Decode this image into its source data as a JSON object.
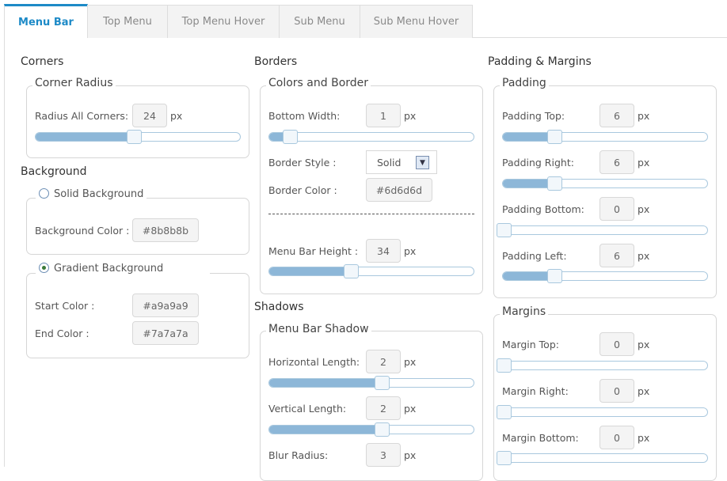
{
  "tabs": [
    {
      "label": "Menu Bar",
      "active": true
    },
    {
      "label": "Top Menu",
      "active": false
    },
    {
      "label": "Top Menu Hover",
      "active": false
    },
    {
      "label": "Sub Menu",
      "active": false
    },
    {
      "label": "Sub Menu Hover",
      "active": false
    }
  ],
  "unit": "px",
  "corners": {
    "heading": "Corners",
    "legend": "Corner Radius",
    "radius_label": "Radius All Corners:",
    "radius_value": "24",
    "radius_slider_fraction": 0.48
  },
  "background": {
    "heading": "Background",
    "solid_legend": "Solid Background",
    "solid_selected": false,
    "bg_color_label": "Background Color :",
    "bg_color": "#8b8b8b",
    "gradient_legend": "Gradient Background",
    "gradient_selected": true,
    "start_label": "Start Color :",
    "start_color": "#a9a9a9",
    "end_label": "End Color :",
    "end_color": "#7a7a7a"
  },
  "borders": {
    "heading": "Borders",
    "legend": "Colors and Border",
    "bottom_width_label": "Bottom Width:",
    "bottom_width_value": "1",
    "bottom_width_fraction": 0.1,
    "style_label": "Border Style :",
    "style_value": "Solid",
    "color_label": "Border Color :",
    "color_value": "#6d6d6d",
    "height_label": "Menu Bar Height :",
    "height_value": "34",
    "height_fraction": 0.4
  },
  "shadows": {
    "heading": "Shadows",
    "legend": "Menu Bar Shadow",
    "horizontal_label": "Horizontal Length:",
    "horizontal_value": "2",
    "horizontal_fraction": 0.55,
    "vertical_label": "Vertical Length:",
    "vertical_value": "2",
    "vertical_fraction": 0.55,
    "blur_label": "Blur Radius:",
    "blur_value": "3"
  },
  "padding_margins": {
    "heading": "Padding & Margins",
    "padding_legend": "Padding",
    "padding_top_label": "Padding Top:",
    "padding_top_value": "6",
    "padding_top_fraction": 0.25,
    "padding_right_label": "Padding Right:",
    "padding_right_value": "6",
    "padding_right_fraction": 0.25,
    "padding_bottom_label": "Padding Bottom:",
    "padding_bottom_value": "0",
    "padding_bottom_fraction": 0,
    "padding_left_label": "Padding Left:",
    "padding_left_value": "6",
    "padding_left_fraction": 0.25,
    "margins_legend": "Margins",
    "margin_top_label": "Margin Top:",
    "margin_top_value": "0",
    "margin_top_fraction": 0,
    "margin_right_label": "Margin Right:",
    "margin_right_value": "0",
    "margin_right_fraction": 0,
    "margin_bottom_label": "Margin Bottom:",
    "margin_bottom_value": "0",
    "margin_bottom_fraction": 0
  }
}
